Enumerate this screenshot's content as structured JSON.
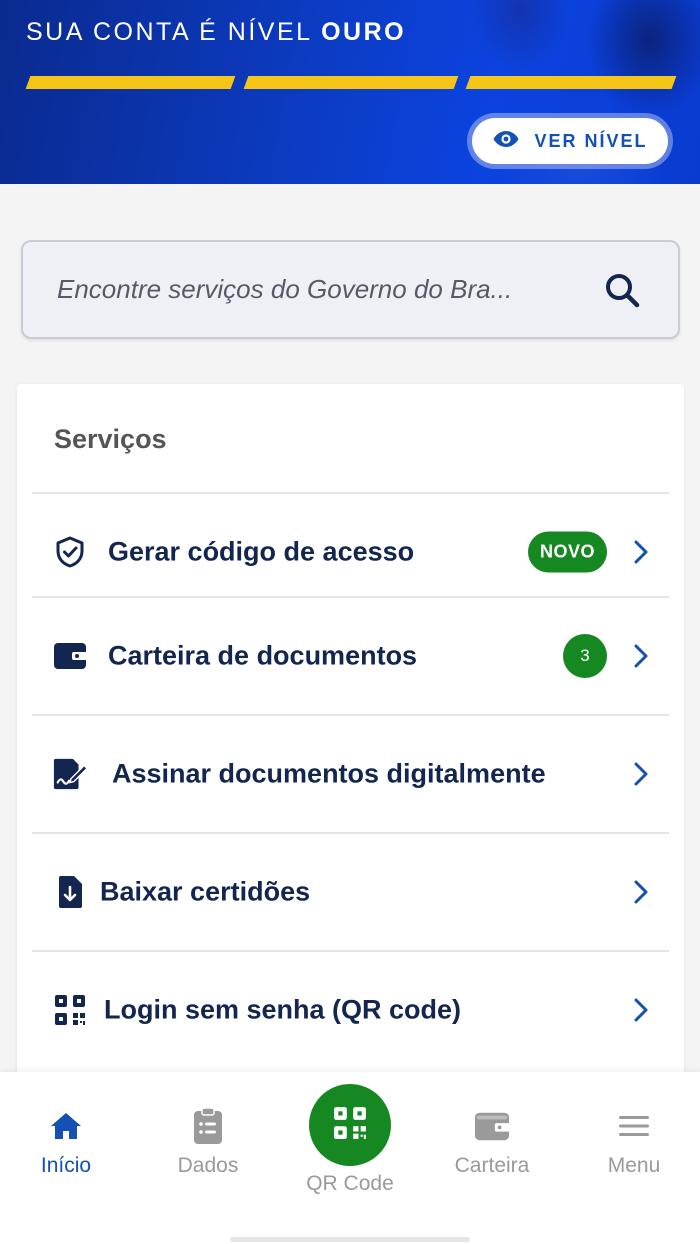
{
  "banner": {
    "title_prefix": "SUA CONTA É NÍVEL ",
    "title_level": "OURO",
    "progress_filled_segments": 3,
    "progress_total_segments": 3,
    "ver_nivel_label": "VER NÍVEL",
    "ver_nivel_icon": "eye-icon",
    "accent_color": "#f5c518"
  },
  "search": {
    "placeholder": "Encontre serviços do Governo do Bra...",
    "icon": "search-icon"
  },
  "services": {
    "title": "Serviços",
    "items": [
      {
        "label": "Gerar código de acesso",
        "icon": "shield-check-icon",
        "badge": "NOVO"
      },
      {
        "label": "Carteira de documentos",
        "icon": "wallet-icon",
        "badge": "3"
      },
      {
        "label": "Assinar documentos digitalmente",
        "icon": "sign-document-icon"
      },
      {
        "label": "Baixar certidões",
        "icon": "download-file-icon"
      },
      {
        "label": "Login sem senha (QR code)",
        "icon": "qr-code-icon"
      }
    ]
  },
  "bottom_nav": {
    "items": [
      {
        "label": "Início",
        "icon": "home-icon",
        "active": true
      },
      {
        "label": "Dados",
        "icon": "clipboard-icon",
        "active": false
      },
      {
        "label": "QR Code",
        "icon": "qr-code-icon",
        "active": false
      },
      {
        "label": "Carteira",
        "icon": "wallet-icon",
        "active": false
      },
      {
        "label": "Menu",
        "icon": "hamburger-menu-icon",
        "active": false
      }
    ]
  },
  "colors": {
    "primary_blue": "#1351b4",
    "text_dark_blue": "#13264f",
    "success_green": "#168821"
  }
}
